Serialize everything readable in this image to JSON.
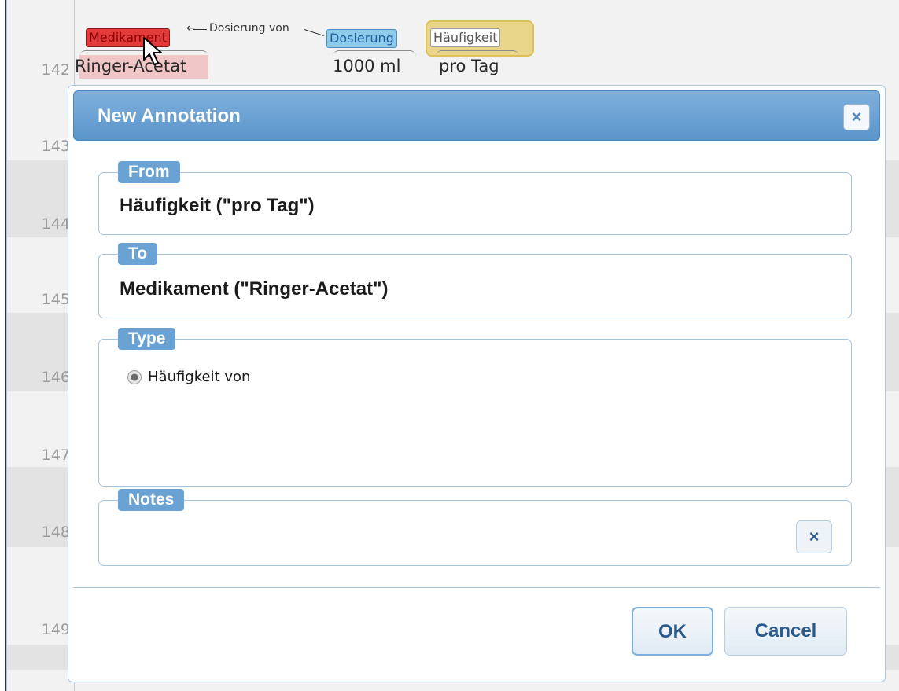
{
  "editor": {
    "line_numbers": [
      "142",
      "143",
      "144",
      "145",
      "146",
      "147",
      "148",
      "149"
    ],
    "annotations": {
      "medikament_label": "Medikament",
      "dosierung_label": "Dosierung",
      "haeufigkeit_label": "Häufigkeit",
      "arc_label": "Dosierung von"
    },
    "tokens": {
      "medication": "Ringer-Acetat",
      "dose": "1000 ml",
      "frequency": "pro Tag"
    }
  },
  "dialog": {
    "title": "New Annotation",
    "close_icon": "×",
    "from": {
      "legend": "From",
      "value": "Häufigkeit (\"pro Tag\")"
    },
    "to": {
      "legend": "To",
      "value": "Medikament (\"Ringer-Acetat\")"
    },
    "type": {
      "legend": "Type",
      "options": [
        {
          "label": "Häufigkeit von",
          "selected": true
        }
      ]
    },
    "notes": {
      "legend": "Notes",
      "value": "",
      "clear_icon": "×"
    },
    "buttons": {
      "ok": "OK",
      "cancel": "Cancel"
    }
  },
  "colors": {
    "medikament": "#e33b3b",
    "dosierung": "#8ecbea",
    "dialog_header": "#6aa3d3"
  }
}
